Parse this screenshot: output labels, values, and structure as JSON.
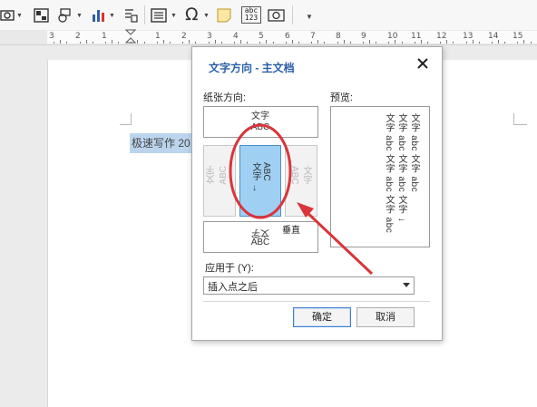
{
  "toolbar": {
    "icons": [
      "screenshot-icon",
      "picture-icon",
      "shapes-icon",
      "chart-icon",
      "text-box-icon",
      "header-footer-icon",
      "symbol-icon",
      "note-icon",
      "field-icon",
      "object-icon",
      "more-icon"
    ],
    "symbol_glyph": "Ω",
    "field_glyph_top": "abc",
    "field_glyph_bottom": "123"
  },
  "ruler": {
    "numbers": [
      "3",
      "2",
      "1",
      "1",
      "2",
      "3",
      "4",
      "5",
      "6",
      "7",
      "8",
      "9",
      "10",
      "11",
      "12",
      "13",
      "14",
      "15"
    ]
  },
  "document": {
    "highlighted_text": "极速写作 20"
  },
  "dialog": {
    "title": "文字方向 - 主文档",
    "orientation_label": "纸张方向:",
    "preview_label": "预览:",
    "options": {
      "top_text_line1": "文字",
      "top_text_line2": "ABC",
      "left_text_line1": "文字",
      "left_text_line2": "ABC",
      "selected_text_line1": "ABC",
      "selected_text_line2": "文字",
      "selected_arrow": "↓",
      "right_text_line1": "文字",
      "right_text_line2": "ABC",
      "bottom_text_line1": "文字",
      "bottom_text_line2": "ABC",
      "tooltip": "垂直"
    },
    "preview_columns": [
      "文字 abc 文字 abc",
      "文字 abc 文字 abc 文字 ↓",
      "文字 abc 文字 abc 文字 abc"
    ],
    "apply_to_label": "应用于 (Y):",
    "apply_to_value": "插入点之后",
    "ok_label": "确定",
    "cancel_label": "取消"
  },
  "colors": {
    "annotation_red": "#d9353a",
    "selected_blue": "#9fd0f3",
    "title_blue": "#2b5fa8"
  }
}
